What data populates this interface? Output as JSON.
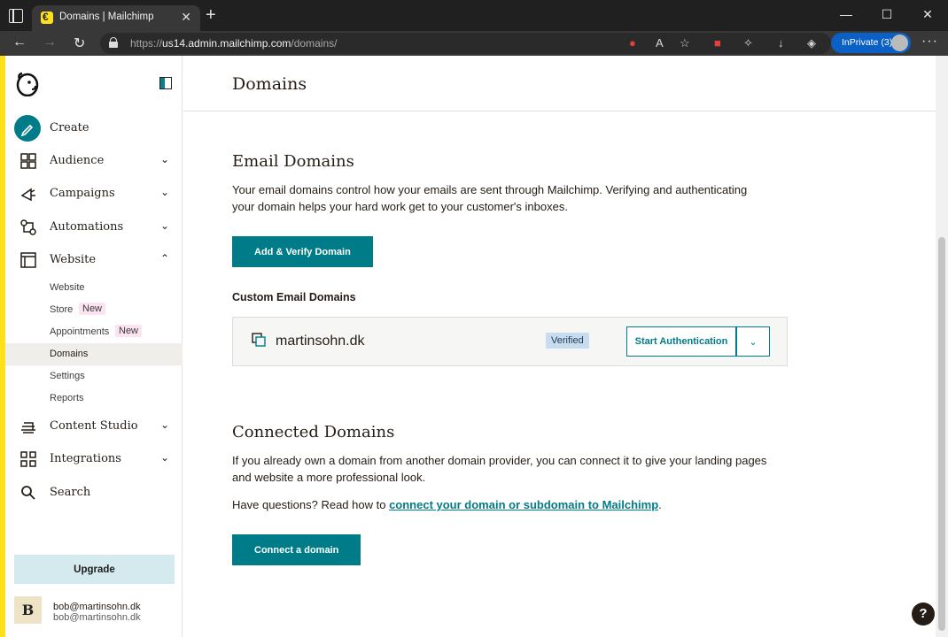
{
  "browser": {
    "tab_title": "Domains | Mailchimp",
    "url_domain": "us14.admin.mailchimp.com",
    "url_path": "/domains/",
    "url_scheme": "https://",
    "inprivate_label": "InPrivate (3)",
    "icons": [
      "sidebar-icon",
      "close-icon",
      "plus-icon",
      "back-icon",
      "forward-icon",
      "reload-icon",
      "lock-icon",
      "read-aloud-icon",
      "favorites-icon",
      "extensions-icon",
      "download-icon",
      "more-icon"
    ]
  },
  "sidebar": {
    "nav": [
      {
        "label": "Create",
        "icon": "pencil-icon"
      },
      {
        "label": "Audience",
        "icon": "audience-icon"
      },
      {
        "label": "Campaigns",
        "icon": "megaphone-icon"
      },
      {
        "label": "Automations",
        "icon": "automation-icon"
      },
      {
        "label": "Website",
        "icon": "website-icon"
      },
      {
        "label": "Content Studio",
        "icon": "content-studio-icon"
      },
      {
        "label": "Integrations",
        "icon": "grid-icon"
      },
      {
        "label": "Search",
        "icon": "search-icon"
      }
    ],
    "website_sub": [
      {
        "label": "Website"
      },
      {
        "label": "Store",
        "badge": "New"
      },
      {
        "label": "Appointments",
        "badge": "New"
      },
      {
        "label": "Domains"
      },
      {
        "label": "Settings"
      },
      {
        "label": "Reports"
      }
    ],
    "upgrade_label": "Upgrade",
    "user": {
      "initial": "B",
      "name": "bob@martinsohn.dk",
      "email": "bob@martinsohn.dk"
    }
  },
  "main": {
    "page_title": "Domains",
    "email_domains": {
      "heading": "Email Domains",
      "description": "Your email domains control how your emails are sent through Mailchimp. Verifying and authenticating your domain helps your hard work get to your customer's inboxes.",
      "add_button": "Add & Verify Domain",
      "custom_heading": "Custom Email Domains",
      "domain": {
        "name": "martinsohn.dk",
        "status": "Verified",
        "action": "Start Authentication"
      }
    },
    "connected_domains": {
      "heading": "Connected Domains",
      "description": "If you already own a domain from another domain provider, you can connect it to give your landing pages and website a more professional look.",
      "question_prefix": "Have questions? Read how to ",
      "question_link": "connect your domain or subdomain to Mailchimp",
      "question_suffix": ".",
      "connect_button": "Connect a domain"
    },
    "help_label": "?"
  },
  "colors": {
    "brand_yellow": "#ffe01b",
    "teal": "#007c89",
    "browser_dark": "#202020"
  }
}
